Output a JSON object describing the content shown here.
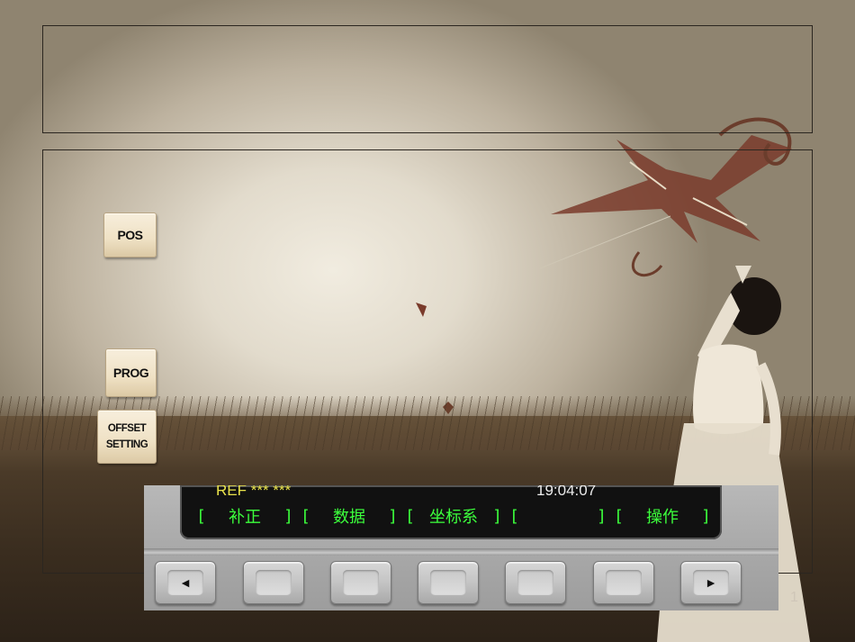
{
  "keys": {
    "pos": "POS",
    "prog": "PROG",
    "offset_line1": "OFFSET",
    "offset_line2": "SETTING"
  },
  "cnc_screen": {
    "status": "REF *** ***",
    "time": "19:04:07",
    "softkeys": [
      {
        "open": "[",
        "label": "补正",
        "close": "]"
      },
      {
        "open": "[",
        "label": "数据",
        "close": "]"
      },
      {
        "open": "[",
        "label": "坐标系",
        "close": "]"
      },
      {
        "open": "[",
        "label": "",
        "close": "]"
      },
      {
        "open": "[",
        "label": "操作",
        "close": "]"
      }
    ]
  },
  "hardware_keys": [
    "◄",
    "",
    "",
    "",
    "",
    "",
    "►"
  ],
  "page_number": "1",
  "colors": {
    "softkey_text": "#3cff3c",
    "status_text": "#e9e24b",
    "key_face": "#efe1c4"
  }
}
